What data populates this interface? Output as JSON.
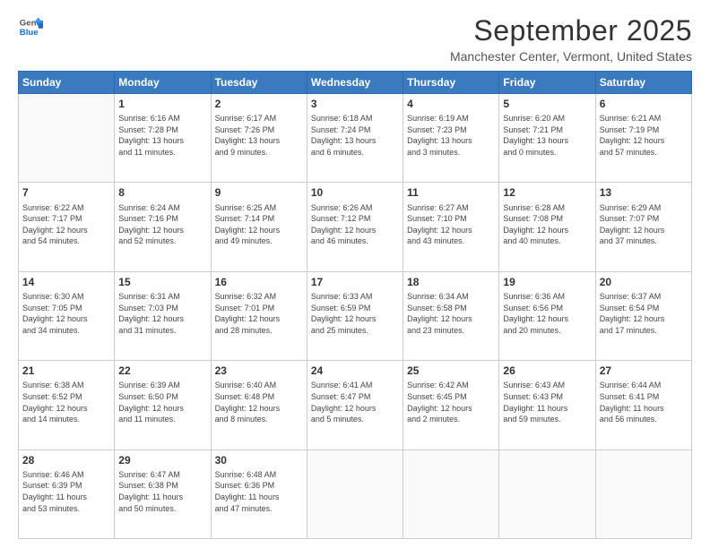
{
  "header": {
    "logo": {
      "general": "General",
      "blue": "Blue"
    },
    "title": "September 2025",
    "location": "Manchester Center, Vermont, United States"
  },
  "calendar": {
    "weekdays": [
      "Sunday",
      "Monday",
      "Tuesday",
      "Wednesday",
      "Thursday",
      "Friday",
      "Saturday"
    ],
    "weeks": [
      [
        {
          "day": "",
          "info": ""
        },
        {
          "day": "1",
          "info": "Sunrise: 6:16 AM\nSunset: 7:28 PM\nDaylight: 13 hours\nand 11 minutes."
        },
        {
          "day": "2",
          "info": "Sunrise: 6:17 AM\nSunset: 7:26 PM\nDaylight: 13 hours\nand 9 minutes."
        },
        {
          "day": "3",
          "info": "Sunrise: 6:18 AM\nSunset: 7:24 PM\nDaylight: 13 hours\nand 6 minutes."
        },
        {
          "day": "4",
          "info": "Sunrise: 6:19 AM\nSunset: 7:23 PM\nDaylight: 13 hours\nand 3 minutes."
        },
        {
          "day": "5",
          "info": "Sunrise: 6:20 AM\nSunset: 7:21 PM\nDaylight: 13 hours\nand 0 minutes."
        },
        {
          "day": "6",
          "info": "Sunrise: 6:21 AM\nSunset: 7:19 PM\nDaylight: 12 hours\nand 57 minutes."
        }
      ],
      [
        {
          "day": "7",
          "info": "Sunrise: 6:22 AM\nSunset: 7:17 PM\nDaylight: 12 hours\nand 54 minutes."
        },
        {
          "day": "8",
          "info": "Sunrise: 6:24 AM\nSunset: 7:16 PM\nDaylight: 12 hours\nand 52 minutes."
        },
        {
          "day": "9",
          "info": "Sunrise: 6:25 AM\nSunset: 7:14 PM\nDaylight: 12 hours\nand 49 minutes."
        },
        {
          "day": "10",
          "info": "Sunrise: 6:26 AM\nSunset: 7:12 PM\nDaylight: 12 hours\nand 46 minutes."
        },
        {
          "day": "11",
          "info": "Sunrise: 6:27 AM\nSunset: 7:10 PM\nDaylight: 12 hours\nand 43 minutes."
        },
        {
          "day": "12",
          "info": "Sunrise: 6:28 AM\nSunset: 7:08 PM\nDaylight: 12 hours\nand 40 minutes."
        },
        {
          "day": "13",
          "info": "Sunrise: 6:29 AM\nSunset: 7:07 PM\nDaylight: 12 hours\nand 37 minutes."
        }
      ],
      [
        {
          "day": "14",
          "info": "Sunrise: 6:30 AM\nSunset: 7:05 PM\nDaylight: 12 hours\nand 34 minutes."
        },
        {
          "day": "15",
          "info": "Sunrise: 6:31 AM\nSunset: 7:03 PM\nDaylight: 12 hours\nand 31 minutes."
        },
        {
          "day": "16",
          "info": "Sunrise: 6:32 AM\nSunset: 7:01 PM\nDaylight: 12 hours\nand 28 minutes."
        },
        {
          "day": "17",
          "info": "Sunrise: 6:33 AM\nSunset: 6:59 PM\nDaylight: 12 hours\nand 25 minutes."
        },
        {
          "day": "18",
          "info": "Sunrise: 6:34 AM\nSunset: 6:58 PM\nDaylight: 12 hours\nand 23 minutes."
        },
        {
          "day": "19",
          "info": "Sunrise: 6:36 AM\nSunset: 6:56 PM\nDaylight: 12 hours\nand 20 minutes."
        },
        {
          "day": "20",
          "info": "Sunrise: 6:37 AM\nSunset: 6:54 PM\nDaylight: 12 hours\nand 17 minutes."
        }
      ],
      [
        {
          "day": "21",
          "info": "Sunrise: 6:38 AM\nSunset: 6:52 PM\nDaylight: 12 hours\nand 14 minutes."
        },
        {
          "day": "22",
          "info": "Sunrise: 6:39 AM\nSunset: 6:50 PM\nDaylight: 12 hours\nand 11 minutes."
        },
        {
          "day": "23",
          "info": "Sunrise: 6:40 AM\nSunset: 6:48 PM\nDaylight: 12 hours\nand 8 minutes."
        },
        {
          "day": "24",
          "info": "Sunrise: 6:41 AM\nSunset: 6:47 PM\nDaylight: 12 hours\nand 5 minutes."
        },
        {
          "day": "25",
          "info": "Sunrise: 6:42 AM\nSunset: 6:45 PM\nDaylight: 12 hours\nand 2 minutes."
        },
        {
          "day": "26",
          "info": "Sunrise: 6:43 AM\nSunset: 6:43 PM\nDaylight: 11 hours\nand 59 minutes."
        },
        {
          "day": "27",
          "info": "Sunrise: 6:44 AM\nSunset: 6:41 PM\nDaylight: 11 hours\nand 56 minutes."
        }
      ],
      [
        {
          "day": "28",
          "info": "Sunrise: 6:46 AM\nSunset: 6:39 PM\nDaylight: 11 hours\nand 53 minutes."
        },
        {
          "day": "29",
          "info": "Sunrise: 6:47 AM\nSunset: 6:38 PM\nDaylight: 11 hours\nand 50 minutes."
        },
        {
          "day": "30",
          "info": "Sunrise: 6:48 AM\nSunset: 6:36 PM\nDaylight: 11 hours\nand 47 minutes."
        },
        {
          "day": "",
          "info": ""
        },
        {
          "day": "",
          "info": ""
        },
        {
          "day": "",
          "info": ""
        },
        {
          "day": "",
          "info": ""
        }
      ]
    ]
  }
}
